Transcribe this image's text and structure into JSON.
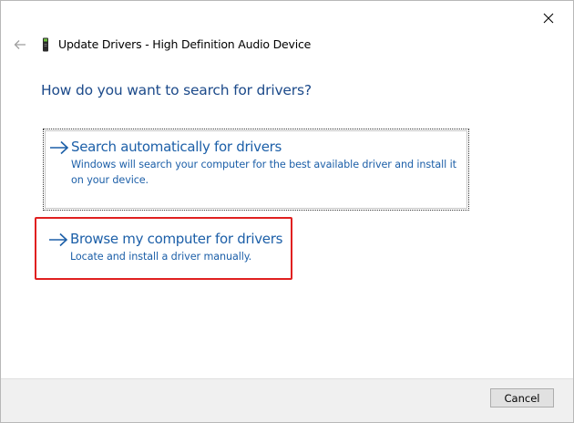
{
  "window": {
    "title": "Update Drivers - High Definition Audio Device"
  },
  "icons": {
    "close": "close-icon",
    "back": "back-arrow-icon",
    "device": "audio-device-icon",
    "option_arrow": "right-arrow-icon"
  },
  "main": {
    "heading": "How do you want to search for drivers?",
    "options": [
      {
        "title": "Search automatically for drivers",
        "description": "Windows will search your computer for the best available driver and install it on your device."
      },
      {
        "title": "Browse my computer for drivers",
        "description": "Locate and install a driver manually."
      }
    ]
  },
  "footer": {
    "cancel_label": "Cancel"
  },
  "colors": {
    "link_blue": "#1c5fa8",
    "heading_blue": "#1c4a8a",
    "highlight_red": "#e02020",
    "footer_bg": "#f0f0f0"
  }
}
